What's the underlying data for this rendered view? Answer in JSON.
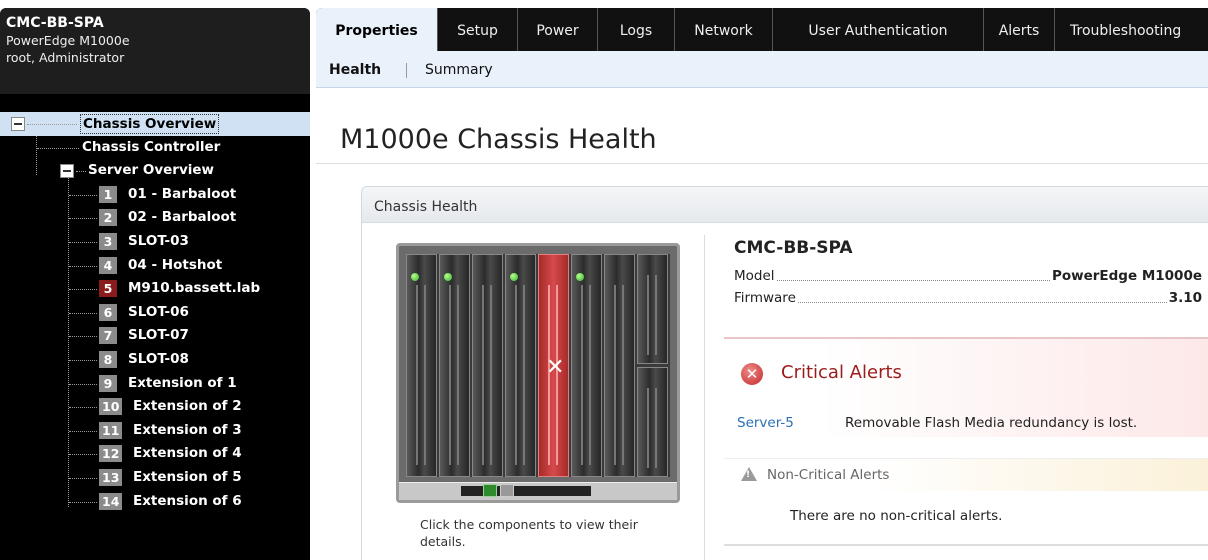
{
  "sidebar": {
    "title": "CMC-BB-SPA",
    "model": "PowerEdge M1000e",
    "user": "root, Administrator",
    "tree": {
      "chassis_overview": "Chassis Overview",
      "chassis_controller": "Chassis Controller",
      "server_overview": "Server Overview",
      "servers": [
        {
          "num": "1",
          "label": "01 - Barbaloot",
          "status": "normal"
        },
        {
          "num": "2",
          "label": "02 - Barbaloot",
          "status": "normal"
        },
        {
          "num": "3",
          "label": "SLOT-03",
          "status": "normal"
        },
        {
          "num": "4",
          "label": "04 - Hotshot",
          "status": "normal"
        },
        {
          "num": "5",
          "label": "M910.bassett.lab",
          "status": "critical"
        },
        {
          "num": "6",
          "label": "SLOT-06",
          "status": "normal"
        },
        {
          "num": "7",
          "label": "SLOT-07",
          "status": "normal"
        },
        {
          "num": "8",
          "label": "SLOT-08",
          "status": "normal"
        },
        {
          "num": "9",
          "label": "Extension of 1",
          "status": "normal"
        },
        {
          "num": "10",
          "label": "Extension of 2",
          "status": "normal"
        },
        {
          "num": "11",
          "label": "Extension of 3",
          "status": "normal"
        },
        {
          "num": "12",
          "label": "Extension of 4",
          "status": "normal"
        },
        {
          "num": "13",
          "label": "Extension of 5",
          "status": "normal"
        },
        {
          "num": "14",
          "label": "Extension of 6",
          "status": "normal"
        }
      ]
    }
  },
  "tabs": [
    "Properties",
    "Setup",
    "Power",
    "Logs",
    "Network",
    "User Authentication",
    "Alerts",
    "Troubleshooting"
  ],
  "active_tab": "Properties",
  "subtabs": [
    "Health",
    "Summary"
  ],
  "active_subtab": "Health",
  "page_title": "M1000e Chassis Health",
  "panel": {
    "title": "Chassis Health",
    "click_hint": "Click the components to view their details."
  },
  "info": {
    "name": "CMC-BB-SPA",
    "model_label": "Model",
    "model_value": "PowerEdge M1000e",
    "firmware_label": "Firmware",
    "firmware_value": "3.10"
  },
  "critical": {
    "title": "Critical Alerts",
    "source": "Server-5",
    "message": "Removable Flash Media redundancy is lost."
  },
  "noncritical": {
    "title": "Non-Critical Alerts",
    "message": "There are no non-critical alerts."
  },
  "colors": {
    "critical": "#9c1b1b",
    "link": "#2a6fb5",
    "healthy_led": "#2fb02f",
    "selected_tree": "#cfe1f3"
  }
}
